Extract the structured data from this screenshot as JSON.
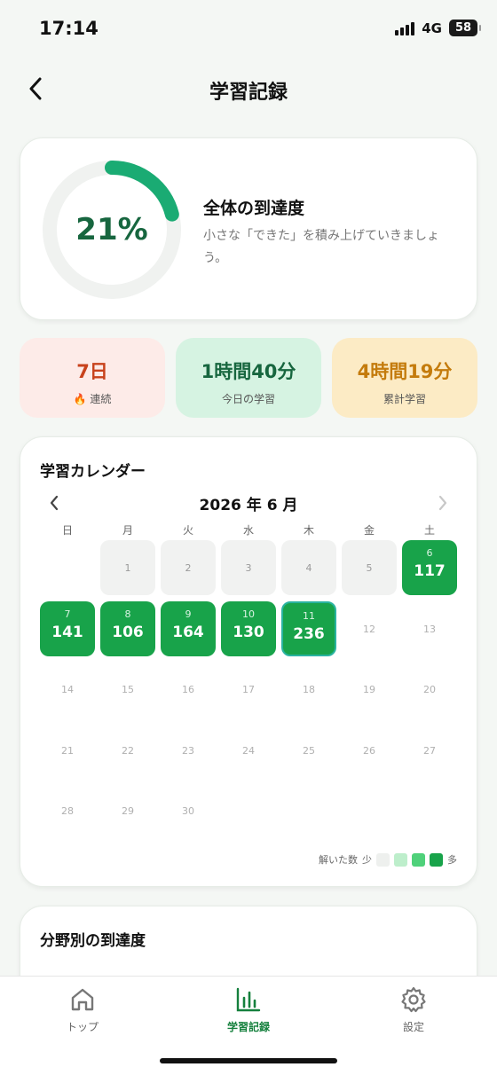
{
  "status_bar": {
    "time": "17:14",
    "network": "4G",
    "battery": "58"
  },
  "header": {
    "title": "学習記録",
    "back_icon": "chevron-left-icon"
  },
  "progress": {
    "percent_label": "21%",
    "percent_value": 21,
    "title": "全体の到達度",
    "subtitle": "小さな「できた」を積み上げていきましょう。"
  },
  "stats": {
    "streak": {
      "value": "7日",
      "label": "🔥 連続"
    },
    "today": {
      "value": "1時間40分",
      "label": "今日の学習"
    },
    "total": {
      "value": "4時間19分",
      "label": "累計学習"
    }
  },
  "calendar": {
    "title": "学習カレンダー",
    "month": "2026 年 6 月",
    "weekdays": [
      "日",
      "月",
      "火",
      "水",
      "木",
      "金",
      "土"
    ],
    "start_weekday": 1,
    "days_in_month": 30,
    "today": 11,
    "counts": {
      "6": 117,
      "7": 141,
      "8": 106,
      "9": 164,
      "10": 130,
      "11": 236
    },
    "legend": {
      "label": "解いた数",
      "low": "少",
      "high": "多",
      "colors": [
        "#eef0ee",
        "#bdeecb",
        "#4fd17a",
        "#18a34a"
      ]
    },
    "colors": {
      "active": "#18a34a",
      "past": "#f1f2f1"
    }
  },
  "field_section": {
    "title": "分野別の到達度"
  },
  "tabs": [
    {
      "label": "トップ",
      "icon": "home-icon"
    },
    {
      "label": "学習記録",
      "icon": "bar-chart-icon"
    },
    {
      "label": "設定",
      "icon": "gear-icon"
    }
  ],
  "colors": {
    "accent": "#18a34a",
    "ring_track": "#f0f2f0",
    "ring_fill": "#1aab73"
  }
}
